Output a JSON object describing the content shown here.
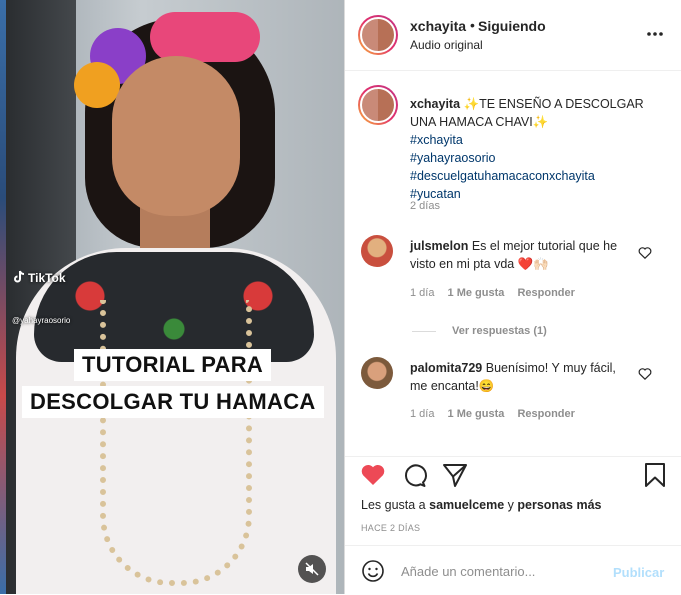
{
  "header": {
    "username": "xchayita",
    "separator": "•",
    "follow_status": "Siguiendo",
    "audio": "Audio original",
    "more_icon": "more-icon"
  },
  "media": {
    "tiktok_label": "TikTok",
    "tiktok_handle": "@yahayraosorio",
    "caption_line_1": "TUTORIAL PARA",
    "caption_line_2": "DESCOLGAR TU HAMACA",
    "mute_icon": "mute-icon"
  },
  "caption": {
    "username": "xchayita",
    "text": "✨TE ENSEÑO A DESCOLGAR UNA HAMACA CHAVI✨",
    "hashtags": [
      "#xchayita",
      "#yahayraosorio",
      "#descuelgatuhamacaconxchayita",
      "#yucatan"
    ],
    "time": "2 días"
  },
  "comments": [
    {
      "username": "julsmelon",
      "text": "Es el mejor tutorial que he visto en mi pta vda ❤️🙌🏻",
      "time": "1 día",
      "likes": "1 Me gusta",
      "reply": "Responder",
      "view_replies": "Ver respuestas (1)"
    },
    {
      "username": "palomita729",
      "text": "Buenísimo! Y muy fácil, me encanta!😄",
      "time": "1 día",
      "likes": "1 Me gusta",
      "reply": "Responder"
    }
  ],
  "actions": {
    "likes_prefix": "Les gusta a",
    "liked_by": "samuelceme",
    "likes_conjunction": "y",
    "likes_others": "personas más",
    "date": "HACE 2 DÍAS",
    "like_color": "#ed4956"
  },
  "add_comment": {
    "placeholder": "Añade un comentario...",
    "post_label": "Publicar"
  }
}
